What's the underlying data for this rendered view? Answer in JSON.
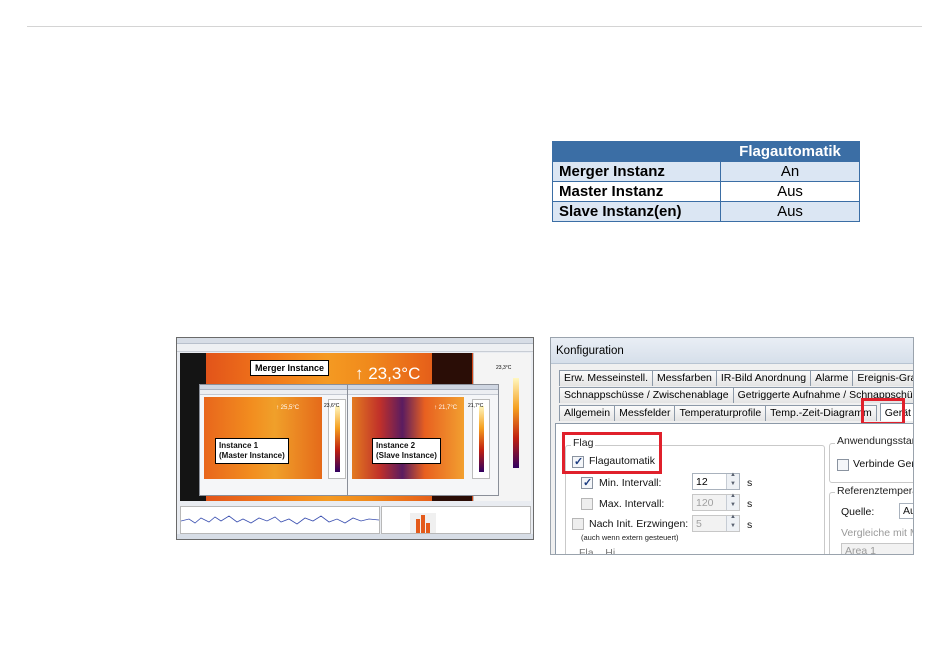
{
  "table": {
    "header": [
      "",
      "Flagautomatik"
    ],
    "rows": [
      {
        "label": "Merger Instanz",
        "value": "An"
      },
      {
        "label": "Master Instanz",
        "value": "Aus"
      },
      {
        "label": "Slave Instanz(en)",
        "value": "Aus"
      }
    ],
    "header_color": "#3b6ea5",
    "stripe_color": "#dbe6f3"
  },
  "left_screenshot": {
    "merger_label": "Merger Instance",
    "big_temperature": "↑ 23,3°C",
    "side_temperature": "23,3°C",
    "instance1": {
      "line1": "Instance 1",
      "line2": "(Master Instance)",
      "temp": "↑ 25,5°C",
      "side_temp": "23,6°C"
    },
    "instance2": {
      "line1": "Instance 2",
      "line2": "(Slave Instance)",
      "temp": "↑ 21,7°C",
      "side_temp": "21,7°C"
    }
  },
  "config_dialog": {
    "title": "Konfiguration",
    "tabs_row1": [
      "Erw. Messeinstell.",
      "Messfarben",
      "IR-Bild Anordnung",
      "Alarme",
      "Ereignis-Grabb"
    ],
    "tabs_row2": [
      "Schnappschüsse / Zwischenablage",
      "Getriggerte Aufnahme / Schnappschüsse"
    ],
    "tabs_row3": [
      "Allgemein",
      "Messfelder",
      "Temperaturprofile",
      "Temp.-Zeit-Diagramm",
      "Gerät",
      "G"
    ],
    "active_tab": "Gerät",
    "flag_group": {
      "title": "Flag",
      "flagautomatik": {
        "label": "Flagautomatik",
        "checked": true
      },
      "min_intervall": {
        "label": "Min. Intervall:",
        "checked": true,
        "value": "12",
        "unit": "s"
      },
      "max_intervall": {
        "label": "Max. Intervall:",
        "checked": false,
        "value": "120",
        "unit": "s"
      },
      "nach_init": {
        "label": "Nach Init. Erzwingen:",
        "checked": false,
        "value": "5",
        "unit": "s",
        "note": "(auch wenn extern gesteuert)"
      },
      "cut_text": "Fla... Hi... ..."
    },
    "anwendung_group": {
      "title": "Anwendungsstart",
      "checkbox_label": "Verbinde Ger"
    },
    "referenz_group": {
      "title": "Referenztempera",
      "quelle_label": "Quelle:",
      "quelle_value": "Au",
      "vergleiche": "Vergleiche mit M",
      "area": "Area 1"
    },
    "highlight_color": "#e0202b"
  }
}
